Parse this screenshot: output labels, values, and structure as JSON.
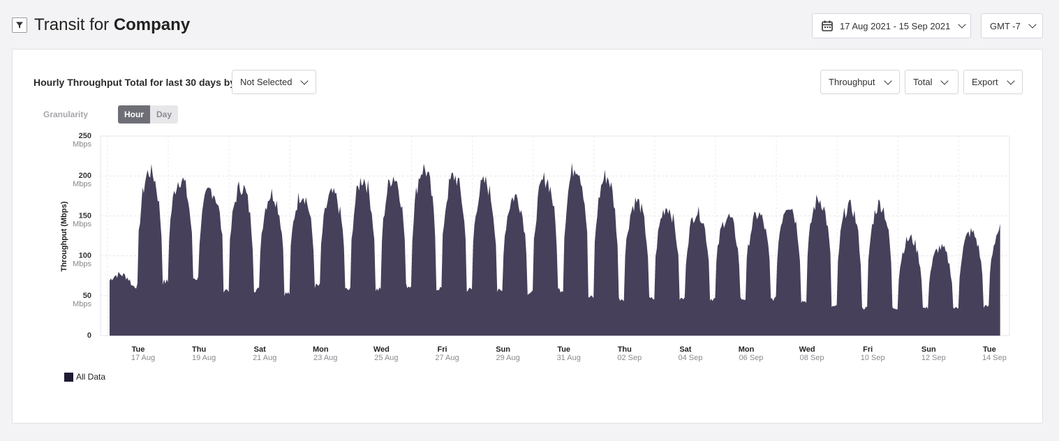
{
  "header": {
    "title_prefix": "Transit for",
    "title_entity": "Company",
    "date_range": "17 Aug 2021 - 15 Sep 2021",
    "timezone": "GMT -7"
  },
  "panel": {
    "title": "Hourly Throughput Total for last 30 days by",
    "group_by": "Not Selected",
    "metric_select": "Throughput",
    "agg_select": "Total",
    "export_label": "Export",
    "granularity_label": "Granularity",
    "granularity_options": [
      "Hour",
      "Day"
    ],
    "granularity_selected": "Hour"
  },
  "colors": {
    "series_fill": "#46405a",
    "legend_swatch": "#1f1b33"
  },
  "chart_data": {
    "type": "area",
    "ylabel": "Throughput (Mbps)",
    "ylim": [
      0,
      250
    ],
    "y_ticks": [
      {
        "value": 250,
        "label": "250",
        "unit": "Mbps"
      },
      {
        "value": 200,
        "label": "200",
        "unit": "Mbps"
      },
      {
        "value": 150,
        "label": "150",
        "unit": "Mbps"
      },
      {
        "value": 100,
        "label": "100",
        "unit": "Mbps"
      },
      {
        "value": 50,
        "label": "50",
        "unit": "Mbps"
      },
      {
        "value": 0,
        "label": "0",
        "unit": ""
      }
    ],
    "x_ticks": [
      {
        "day": "Tue",
        "date": "17 Aug"
      },
      {
        "day": "Thu",
        "date": "19 Aug"
      },
      {
        "day": "Sat",
        "date": "21 Aug"
      },
      {
        "day": "Mon",
        "date": "23 Aug"
      },
      {
        "day": "Wed",
        "date": "25 Aug"
      },
      {
        "day": "Fri",
        "date": "27 Aug"
      },
      {
        "day": "Sun",
        "date": "29 Aug"
      },
      {
        "day": "Tue",
        "date": "31 Aug"
      },
      {
        "day": "Thu",
        "date": "02 Sep"
      },
      {
        "day": "Sat",
        "date": "04 Sep"
      },
      {
        "day": "Mon",
        "date": "06 Sep"
      },
      {
        "day": "Wed",
        "date": "08 Sep"
      },
      {
        "day": "Fri",
        "date": "10 Sep"
      },
      {
        "day": "Sun",
        "date": "12 Sep"
      },
      {
        "day": "Tue",
        "date": "14 Sep"
      }
    ],
    "x_range": [
      "17 Aug 2021",
      "15 Sep 2021"
    ],
    "grid": true,
    "legend_position": "bottom-left",
    "series": [
      {
        "name": "All Data",
        "daily_profile": [
          {
            "date": "16 Aug",
            "peak": 80,
            "trough": 60
          },
          {
            "date": "17 Aug",
            "peak": 215,
            "trough": 65
          },
          {
            "date": "18 Aug",
            "peak": 205,
            "trough": 70
          },
          {
            "date": "19 Aug",
            "peak": 190,
            "trough": 75
          },
          {
            "date": "20 Aug",
            "peak": 195,
            "trough": 60
          },
          {
            "date": "21 Aug",
            "peak": 185,
            "trough": 60
          },
          {
            "date": "22 Aug",
            "peak": 185,
            "trough": 55
          },
          {
            "date": "23 Aug",
            "peak": 185,
            "trough": 65
          },
          {
            "date": "24 Aug",
            "peak": 205,
            "trough": 60
          },
          {
            "date": "25 Aug",
            "peak": 208,
            "trough": 60
          },
          {
            "date": "26 Aug",
            "peak": 218,
            "trough": 65
          },
          {
            "date": "27 Aug",
            "peak": 208,
            "trough": 62
          },
          {
            "date": "28 Aug",
            "peak": 200,
            "trough": 60
          },
          {
            "date": "29 Aug",
            "peak": 182,
            "trough": 58
          },
          {
            "date": "30 Aug",
            "peak": 205,
            "trough": 56
          },
          {
            "date": "31 Aug",
            "peak": 222,
            "trough": 60
          },
          {
            "date": "01 Sep",
            "peak": 208,
            "trough": 50
          },
          {
            "date": "02 Sep",
            "peak": 175,
            "trough": 48
          },
          {
            "date": "03 Sep",
            "peak": 168,
            "trough": 48
          },
          {
            "date": "04 Sep",
            "peak": 162,
            "trough": 48
          },
          {
            "date": "05 Sep",
            "peak": 155,
            "trough": 48
          },
          {
            "date": "06 Sep",
            "peak": 158,
            "trough": 48
          },
          {
            "date": "07 Sep",
            "peak": 172,
            "trough": 48
          },
          {
            "date": "08 Sep",
            "peak": 178,
            "trough": 45
          },
          {
            "date": "09 Sep",
            "peak": 170,
            "trough": 38
          },
          {
            "date": "10 Sep",
            "peak": 172,
            "trough": 36
          },
          {
            "date": "11 Sep",
            "peak": 127,
            "trough": 36
          },
          {
            "date": "12 Sep",
            "peak": 115,
            "trough": 36
          },
          {
            "date": "13 Sep",
            "peak": 135,
            "trough": 36
          },
          {
            "date": "14 Sep",
            "peak": 140,
            "trough": 38
          },
          {
            "date": "15 Sep",
            "peak": 140,
            "trough": 40
          }
        ]
      }
    ]
  }
}
